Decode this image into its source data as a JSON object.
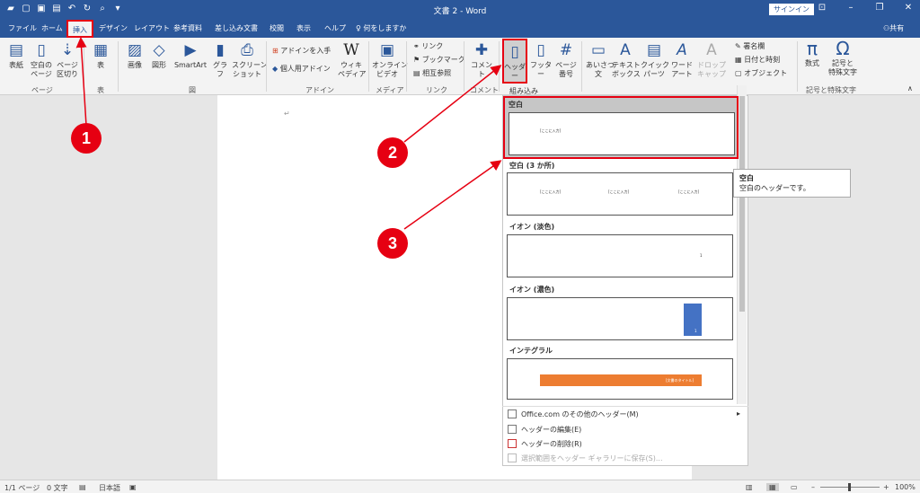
{
  "app": {
    "title": "文書 2  -  Word",
    "signin": "サインイン",
    "share": "共有"
  },
  "tabs": [
    "ファイル",
    "ホーム",
    "挿入",
    "デザイン",
    "レイアウト",
    "参考資料",
    "差し込み文書",
    "校閲",
    "表示",
    "ヘルプ"
  ],
  "tellme": "何をしますか",
  "ribbon": {
    "page_group": {
      "cover": "表紙",
      "blank": "空白の\nページ",
      "break": "ページ\n区切り",
      "name": "ページ"
    },
    "table_group": {
      "table": "表",
      "name": "表"
    },
    "illust_group": {
      "picture": "画像",
      "shapes": "図形",
      "smartart": "SmartArt",
      "chart": "グラフ",
      "screenshot": "スクリーン\nショット",
      "name": "図"
    },
    "addin_group": {
      "get": "アドインを入手",
      "my": "個人用アドイン",
      "wiki": "ウィキ\nペディア",
      "name": "アドイン"
    },
    "media_group": {
      "video": "オンライン\nビデオ",
      "name": "メディア"
    },
    "link_group": {
      "link": "リンク",
      "bookmark": "ブックマーク",
      "crossref": "相互参照",
      "name": "リンク"
    },
    "comment_group": {
      "comment": "コメント",
      "name": "コメント"
    },
    "hf_group": {
      "header": "ヘッダー",
      "footer": "フッター",
      "pageno": "ページ\n番号"
    },
    "text_group": {
      "greeting": "あいさつ\n文",
      "textbox": "テキスト\nボックス",
      "quickparts": "クイック\nパーツ",
      "wordart": "ワード\nアート",
      "dropcap": "ドロップ\nキャップ",
      "sigline": "署名欄",
      "datetime": "日付と時刻",
      "object": "オブジェクト"
    },
    "symbol_group": {
      "equation": "数式",
      "symbol": "記号と\n特殊文字",
      "name": "記号と特殊文字"
    }
  },
  "panel": {
    "builtin": "組み込み",
    "sections": [
      {
        "title": "空白",
        "placeholders": [
          "[ここに入力]"
        ]
      },
      {
        "title": "空白 (3 か所)",
        "placeholders": [
          "[ここに入力]",
          "[ここに入力]",
          "[ここに入力]"
        ]
      },
      {
        "title": "イオン (淡色)",
        "placeholders": [
          "1"
        ]
      },
      {
        "title": "イオン (濃色)",
        "placeholders": [
          "1"
        ]
      },
      {
        "title": "インテグラル",
        "placeholders": [
          "[文書のタイトル]"
        ]
      }
    ],
    "menu": [
      "Office.com のその他のヘッダー(M)",
      "ヘッダーの編集(E)",
      "ヘッダーの削除(R)",
      "選択範囲をヘッダー ギャラリーに保存(S)..."
    ]
  },
  "tooltip": {
    "title": "空白",
    "desc": "空白のヘッダーです。"
  },
  "status": {
    "page": "1/1 ページ",
    "words": "0 文字",
    "lang": "日本語",
    "zoom": "100%"
  },
  "markers": [
    "1",
    "2",
    "3"
  ],
  "colors": {
    "accent": "#2b579a",
    "highlight": "#e60012",
    "integral": "#ed7d31",
    "ion_dark": "#4472c4"
  }
}
